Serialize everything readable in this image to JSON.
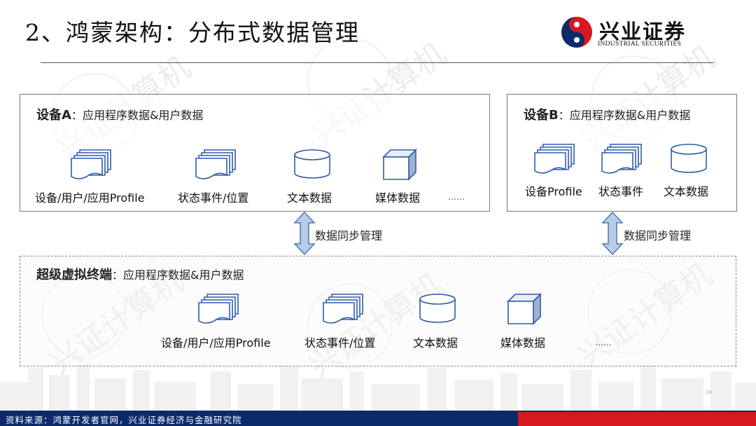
{
  "header": {
    "title": "2、鸿蒙架构：分布式数据管理",
    "logo_name": "兴业证券",
    "logo_sub": "INDUSTRIAL SECURITIES"
  },
  "watermark": "兴证计算机",
  "deviceA": {
    "title": "设备A",
    "subtitle": "：应用程序数据&用户数据",
    "items": [
      {
        "label": "设备/用户/应用Profile",
        "icon": "stacked-pages-icon"
      },
      {
        "label": "状态事件/位置",
        "icon": "stacked-pages-icon"
      },
      {
        "label": "文本数据",
        "icon": "cylinder-database-icon"
      },
      {
        "label": "媒体数据",
        "icon": "cube-icon"
      }
    ],
    "more": "……"
  },
  "deviceB": {
    "title": "设备B",
    "subtitle": "：应用程序数据&用户数据",
    "items": [
      {
        "label": "设备Profile",
        "icon": "stacked-pages-icon"
      },
      {
        "label": "状态事件",
        "icon": "stacked-pages-icon"
      },
      {
        "label": "文本数据",
        "icon": "cylinder-database-icon"
      }
    ]
  },
  "sync": {
    "left": "数据同步管理",
    "right": "数据同步管理"
  },
  "terminal": {
    "title": "超级虚拟终端",
    "subtitle": "：应用程序数据&用户数据",
    "items": [
      {
        "label": "设备/用户/应用Profile",
        "icon": "stacked-pages-icon"
      },
      {
        "label": "状态事件/位置",
        "icon": "stacked-pages-icon"
      },
      {
        "label": "文本数据",
        "icon": "cylinder-database-icon"
      },
      {
        "label": "媒体数据",
        "icon": "cube-icon"
      }
    ],
    "more": "……"
  },
  "page_number": "28",
  "footer": {
    "source": "资料来源：鸿蒙开发者官网，兴业证券经济与金融研究院"
  },
  "colors": {
    "brand_blue": "#0b2a6b",
    "brand_red": "#d6181f",
    "icon_blue": "#2f5ca8",
    "arrow_fill": "#b9cde6"
  }
}
